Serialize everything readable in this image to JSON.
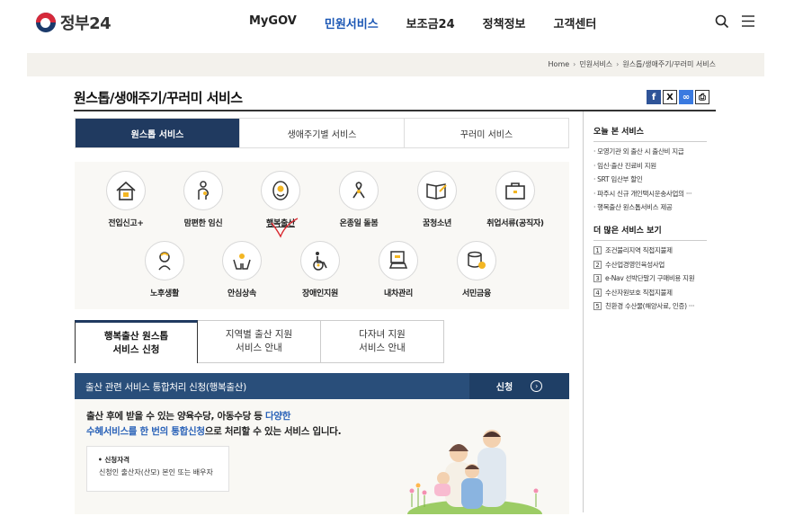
{
  "header": {
    "logo_text": "정부24",
    "nav": [
      "MyGOV",
      "민원서비스",
      "보조금24",
      "정책정보",
      "고객센터"
    ]
  },
  "breadcrumb": [
    "Home",
    "민원서비스",
    "원스톱/생애주기/꾸러미 서비스"
  ],
  "page_title": "원스톱/생애주기/꾸러미 서비스",
  "share": {
    "facebook": "f",
    "x": "X",
    "link": "∞",
    "print": "⎙"
  },
  "top_tabs": [
    "원스톱 서비스",
    "생애주기별 서비스",
    "꾸러미 서비스"
  ],
  "services": [
    "전입신고+",
    "맘편한 임신",
    "행복출산",
    "온종일 돌봄",
    "꿈청소년",
    "취업서류(공직자)",
    "노후생활",
    "안심상속",
    "장애인지원",
    "내차관리",
    "서민금융"
  ],
  "tabs2": [
    {
      "l1": "행복출산 원스톱",
      "l2": "서비스 신청"
    },
    {
      "l1": "지역별 출산 지원",
      "l2": "서비스 안내"
    },
    {
      "l1": "다자녀 지원",
      "l2": "서비스 안내"
    }
  ],
  "banner": {
    "title": "출산 관련 서비스 통합처리 신청(행복출산)",
    "apply": "신청",
    "arrow": "›"
  },
  "content": {
    "line1_a": "출산 후에 받을 수 있는 양육수당, 아동수당 등 ",
    "line1_b": "다양한",
    "line2_a": "수혜서비스를 한 번의 통합신청",
    "line2_b": "으로 처리할 수 있는 서비스 입니다.",
    "elig_title": "• 신청자격",
    "elig_value": "신청인 출산자(산모) 본인 또는 배우자"
  },
  "sidebar": {
    "today_title": "오늘 본 서비스",
    "today": [
      "· 모영기관 외 출산 시 출산비 지급",
      "· 임신·출산 진료비 지원",
      "· SRT 임산부 할인",
      "· 파주시 신규 개인택시운송사업의 ···",
      "· 행복출산 원스톱서비스 제공"
    ],
    "more_title": "더 많은 서비스 보기",
    "more": [
      {
        "n": "1",
        "t": "조건불리지역 직접지불제"
      },
      {
        "n": "2",
        "t": "수산업경영인육성사업"
      },
      {
        "n": "3",
        "t": "e-Nav 선박단말기 구매비용 지원"
      },
      {
        "n": "4",
        "t": "수산자원보호 직접지불제"
      },
      {
        "n": "5",
        "t": "친환경 수산물(해양사료, 인증) ···"
      }
    ]
  }
}
